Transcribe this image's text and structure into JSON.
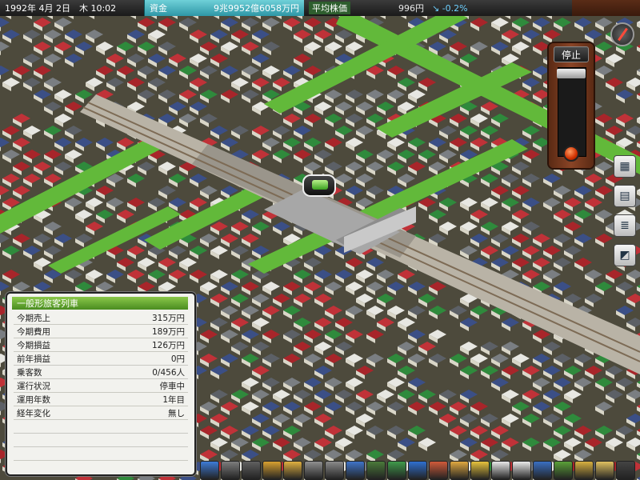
{
  "topbar": {
    "date": "1992年 4月 2日　木 10:02",
    "funds_label": "資金",
    "funds_value": "9兆9952億6058万円",
    "stock_label": "平均株価",
    "stock_value": "996円",
    "stock_change": "↘ -0.2%"
  },
  "speed_control": {
    "state_label": "停止"
  },
  "side_icons": [
    "ministry-icon",
    "calendar-icon",
    "report-icon",
    "diagonal-tool-icon"
  ],
  "info_panel": {
    "title": "一般形旅客列車",
    "rows": [
      {
        "label": "今期売上",
        "value": "315万円"
      },
      {
        "label": "今期費用",
        "value": "189万円"
      },
      {
        "label": "今期損益",
        "value": "126万円"
      },
      {
        "label": "前年損益",
        "value": "0円"
      },
      {
        "label": "乗客数",
        "value": "0/456人"
      },
      {
        "label": "運行状況",
        "value": "停車中"
      },
      {
        "label": "運用年数",
        "value": "1年目"
      },
      {
        "label": "経年変化",
        "value": "無し"
      }
    ]
  },
  "toolbar": {
    "tools": [
      {
        "name": "train-tool-icon",
        "color": "#3d7bd6"
      },
      {
        "name": "track-tool-icon",
        "color": "#7d7d7d"
      },
      {
        "name": "rail-tool-icon",
        "color": "#606060"
      },
      {
        "name": "road-tool-icon",
        "color": "#d8a030"
      },
      {
        "name": "bus-tool-icon",
        "color": "#e0b040"
      },
      {
        "name": "platform-tool-icon",
        "color": "#909090"
      },
      {
        "name": "bridge-tool-icon",
        "color": "#8a8a8a"
      },
      {
        "name": "blue-train-tool-icon",
        "color": "#3f74c8"
      },
      {
        "name": "truck-tool-icon",
        "color": "#4a7a3a"
      },
      {
        "name": "materials-tool-icon",
        "color": "#3f9a4a"
      },
      {
        "name": "arrows-tool-icon",
        "color": "#2f6fd0"
      },
      {
        "name": "building-tool-icon",
        "color": "#d05a3a"
      },
      {
        "name": "box-tool-icon",
        "color": "#e0a840"
      },
      {
        "name": "worker-tool-icon",
        "color": "#e6c23c"
      },
      {
        "name": "graph-tool-icon",
        "color": "#e8e8e8"
      },
      {
        "name": "calculator-tool-icon",
        "color": "#eaeaea"
      },
      {
        "name": "settings-tool-icon",
        "color": "#3a6fc2"
      },
      {
        "name": "terrain-tool-icon",
        "color": "#5aa038"
      },
      {
        "name": "bulldoze-tool-icon",
        "color": "#d8b040"
      },
      {
        "name": "staff-tool-icon",
        "color": "#e0c060"
      },
      {
        "name": "exit-tool-icon",
        "color": "#444444"
      }
    ]
  }
}
